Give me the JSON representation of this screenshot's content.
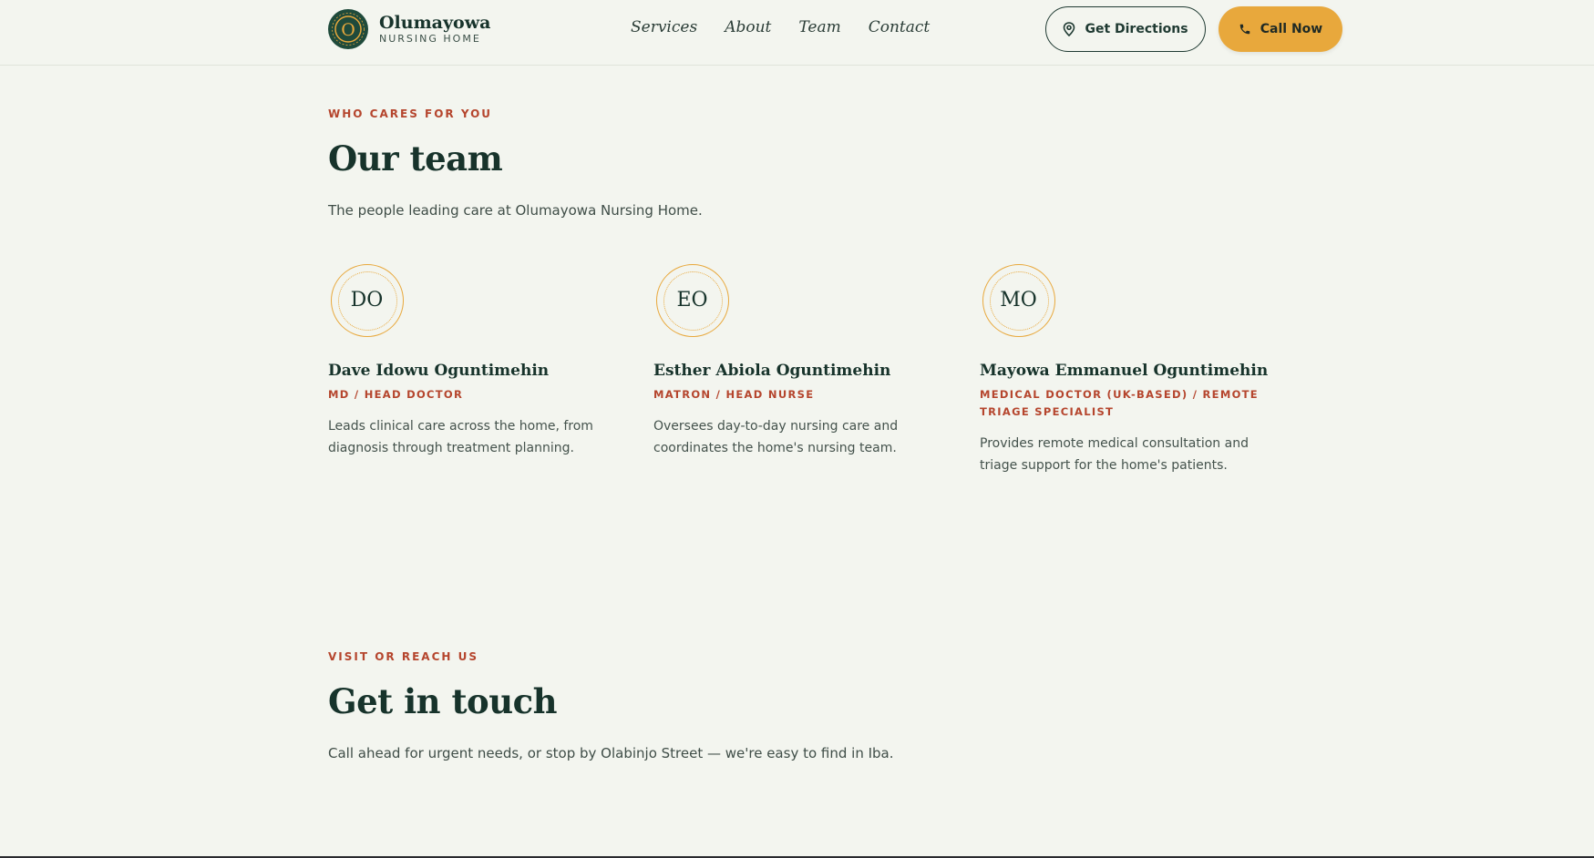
{
  "header": {
    "brand_name": "Olumayowa",
    "brand_sub": "NURSING HOME",
    "logo_letter": "O",
    "nav": [
      "Services",
      "About",
      "Team",
      "Contact"
    ],
    "directions_label": "Get Directions",
    "call_label": "Call Now"
  },
  "team": {
    "eyebrow": "WHO CARES FOR YOU",
    "title": "Our team",
    "lead": "The people leading care at Olumayowa Nursing Home.",
    "members": [
      {
        "initials": "DO",
        "name": "Dave Idowu Oguntimehin",
        "role": "MD / HEAD DOCTOR",
        "bio": "Leads clinical care across the home, from diagnosis through treatment planning."
      },
      {
        "initials": "EO",
        "name": "Esther Abiola Oguntimehin",
        "role": "MATRON / HEAD NURSE",
        "bio": "Oversees day-to-day nursing care and coordinates the home's nursing team."
      },
      {
        "initials": "MO",
        "name": "Mayowa Emmanuel Oguntimehin",
        "role": "MEDICAL DOCTOR (UK-BASED) / REMOTE TRIAGE SPECIALIST",
        "bio": "Provides remote medical consultation and triage support for the home's patients."
      }
    ]
  },
  "contact": {
    "eyebrow": "VISIT OR REACH US",
    "title": "Get in touch",
    "lead": "Call ahead for urgent needs, or stop by Olabinjo Street — we're easy to find in Iba."
  },
  "colors": {
    "background": "#f3f5ef",
    "brand_green": "#1f4a3b",
    "accent_gold": "#e8a83c",
    "eyebrow_red": "#b5452d"
  },
  "icons": {
    "directions": "map-pin-icon",
    "call": "phone-icon"
  }
}
